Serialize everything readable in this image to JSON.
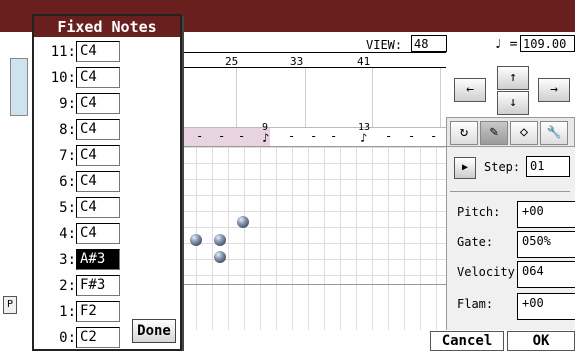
{
  "window": {
    "title_bar_color": "#6a1f1f"
  },
  "view": {
    "label": "VIEW:",
    "value": "48"
  },
  "tempo": {
    "symbol": "♩ =",
    "value": "109.00"
  },
  "ruler": {
    "marks": [
      "25",
      "33",
      "41"
    ]
  },
  "nav_arrows": {
    "left": "←",
    "up": "↑",
    "down": "↓",
    "right": "→"
  },
  "tools": {
    "cycle": "↻",
    "pencil": "✎",
    "eraser": "◇",
    "wrench": "🔧"
  },
  "step": {
    "play": "▶",
    "label": "Step:",
    "value": "01"
  },
  "params": [
    {
      "label": "Pitch:",
      "value": "+00"
    },
    {
      "label": "Gate:",
      "value": "050%"
    },
    {
      "label": "Velocity:",
      "value": "064"
    },
    {
      "label": "Flam:",
      "value": "+00"
    }
  ],
  "footer": {
    "cancel": "Cancel",
    "ok": "OK"
  },
  "left_stub": {
    "btn": "P"
  },
  "fixed_notes": {
    "title": "Fixed Notes",
    "rows": [
      {
        "label": "11:",
        "value": "C4"
      },
      {
        "label": "10:",
        "value": "C4"
      },
      {
        "label": "9:",
        "value": "C4"
      },
      {
        "label": "8:",
        "value": "C4"
      },
      {
        "label": "7:",
        "value": "C4"
      },
      {
        "label": "6:",
        "value": "C4"
      },
      {
        "label": "5:",
        "value": "C4"
      },
      {
        "label": "4:",
        "value": "C4"
      },
      {
        "label": "3:",
        "value": "A#3",
        "selected": true
      },
      {
        "label": "2:",
        "value": "F#3"
      },
      {
        "label": "1:",
        "value": "F2"
      },
      {
        "label": "0:",
        "value": "C2"
      }
    ],
    "done": "Done"
  },
  "dash_row": {
    "marker_a": "9",
    "marker_b": "13"
  }
}
